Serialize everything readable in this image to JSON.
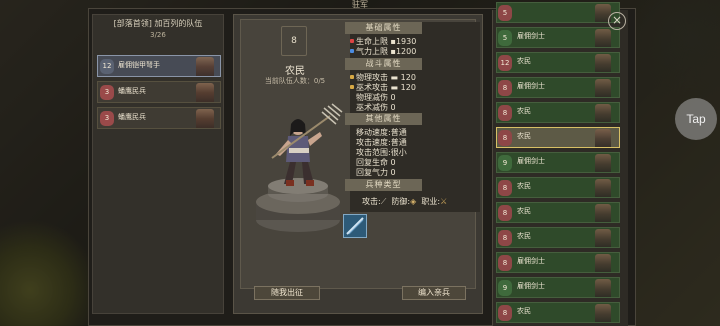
{
  "window": {
    "title": "驻军"
  },
  "overlay": {
    "tap_label": "Tap"
  },
  "left": {
    "title": "[部落首领] 加百列的队伍",
    "count": "3/26",
    "squads": [
      {
        "level": "12",
        "name": "雇佣铠甲弩手"
      },
      {
        "level": "3",
        "name": "蟠鹰民兵"
      },
      {
        "level": "3",
        "name": "蟠鹰民兵"
      }
    ]
  },
  "unit": {
    "level": "8",
    "name": "农民",
    "current_count": "当前队伍人数：0/5"
  },
  "stats": {
    "basic_title": "基础属性",
    "hp_label": "生命上限",
    "hp_value": "1930",
    "qi_label": "气力上限",
    "qi_value": "1200",
    "combat_title": "战斗属性",
    "phys_atk_label": "物理攻击",
    "phys_atk_value": "120",
    "magic_atk_label": "巫术攻击",
    "magic_atk_value": "120",
    "phys_red_label": "物理减伤",
    "phys_red_value": "0",
    "magic_red_label": "巫术减伤",
    "magic_red_value": "0",
    "other_title": "其他属性",
    "move_label": "移动速度",
    "move_value": ":普通",
    "atk_speed_label": "攻击速度",
    "atk_speed_value": ":普通",
    "range_label": "攻击范围",
    "range_value": ":很小",
    "hp_regen_label": "回复生命",
    "hp_regen_value": "0",
    "qi_regen_label": "回复气力",
    "qi_regen_value": "0",
    "type_title": "兵种类型",
    "attack_label": "攻击:",
    "defense_label": "防御:",
    "job_label": "职业:"
  },
  "buttons": {
    "follow": "随我出征",
    "recruit": "编入亲兵"
  },
  "roster": [
    {
      "level": "5",
      "name": "",
      "color": "red"
    },
    {
      "level": "5",
      "name": "雇佣剑士",
      "color": "green"
    },
    {
      "level": "12",
      "name": "农民",
      "color": "red"
    },
    {
      "level": "8",
      "name": "雇佣剑士",
      "color": "red"
    },
    {
      "level": "8",
      "name": "农民",
      "color": "red"
    },
    {
      "level": "8",
      "name": "农民",
      "color": "red",
      "selected": true
    },
    {
      "level": "9",
      "name": "雇佣剑士",
      "color": "green"
    },
    {
      "level": "8",
      "name": "农民",
      "color": "red"
    },
    {
      "level": "8",
      "name": "农民",
      "color": "red"
    },
    {
      "level": "8",
      "name": "农民",
      "color": "red"
    },
    {
      "level": "8",
      "name": "雇佣剑士",
      "color": "red"
    },
    {
      "level": "9",
      "name": "雇佣剑士",
      "color": "green"
    },
    {
      "level": "8",
      "name": "农民",
      "color": "red"
    }
  ]
}
